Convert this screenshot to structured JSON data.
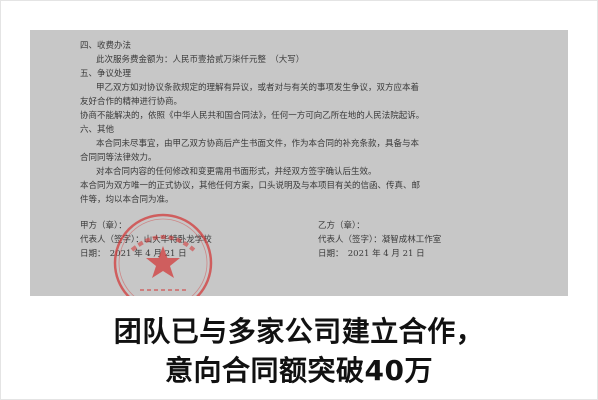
{
  "document": {
    "lines": [
      "四、收费办法",
      "此次服务费金额为：人民币壹拾贰万柒仟元整　（大写）",
      "五、争议处理",
      "甲乙双方如对协议条款规定的理解有异议，或者对与有关的事项发生争议，双方应本着",
      "友好合作的精神进行协商。",
      "协商不能解决的，依照《中华人民共和国合同法》，任何一方可向乙所在地的人民法院起诉。",
      "六、其他",
      "本合同未尽事宜，由甲乙双方协商后产生书面文件，作为本合同的补充条款，具备与本",
      "合同同等法律效力。",
      "对本合同内容的任何修改和变更需用书面形式，并经双方签字确认后生效。",
      "本合同为双方唯一的正式协议，其他任何方案，口头说明及与本项目有关的信函、传真、邮",
      "件等，均以本合同为准。"
    ],
    "party_a_label": "甲方（章）：",
    "party_b_label": "乙方（章）：",
    "rep_a": "代表人（签字）：山大华特卧龙学校",
    "rep_b": "代表人（签字）：凝智成林工作室",
    "date_a": "日期：　2021 年 4 月 21 日",
    "date_b": "日期：　2021 年 4 月 21 日"
  },
  "caption": {
    "line1": "团队已与多家公司建立合作，",
    "line2": "意向合同额突破40万"
  },
  "colors": {
    "photo_bg": "#c7c7c7",
    "ink": "#3a3a3a",
    "seal": "#d23c3c",
    "caption": "#111111"
  }
}
